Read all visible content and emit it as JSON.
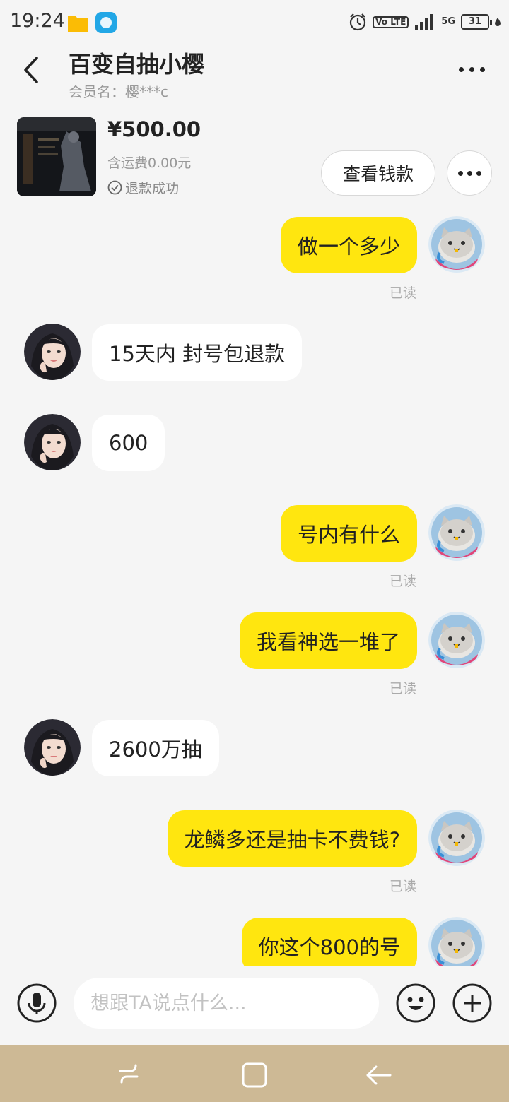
{
  "status_bar": {
    "time": "19:24",
    "volte": "Vo LTE",
    "network": "5G",
    "battery": "31"
  },
  "header": {
    "title": "百变自抽小樱",
    "member": "会员名：樱***c"
  },
  "product": {
    "price": "¥500.00",
    "shipping": "含运费0.00元",
    "status": "退款成功",
    "view_refund_label": "查看钱款"
  },
  "messages": [
    {
      "side": "me",
      "text": "做一个多少",
      "read": "已读"
    },
    {
      "side": "other",
      "text": "15天内 封号包退款"
    },
    {
      "side": "other",
      "text": "600"
    },
    {
      "side": "me",
      "text": "号内有什么",
      "read": "已读"
    },
    {
      "side": "me",
      "text": "我看神选一堆了",
      "read": "已读"
    },
    {
      "side": "other",
      "text": "2600万抽"
    },
    {
      "side": "me",
      "text": "龙鳞多还是抽卡不费钱?",
      "read": "已读"
    },
    {
      "side": "me",
      "text": "你这个800的号"
    }
  ],
  "input": {
    "placeholder": "想跟TA说点什么..."
  },
  "colors": {
    "my_bubble": "#ffe60f",
    "other_bubble": "#ffffff",
    "background": "#f5f5f5",
    "nav_bar": "#cdb995"
  },
  "icons": [
    "back-icon",
    "more-icon",
    "check-circle-icon",
    "microphone-icon",
    "emoji-icon",
    "plus-icon",
    "recent-apps-icon",
    "home-icon",
    "back-nav-icon",
    "alarm-icon",
    "signal-icon"
  ]
}
